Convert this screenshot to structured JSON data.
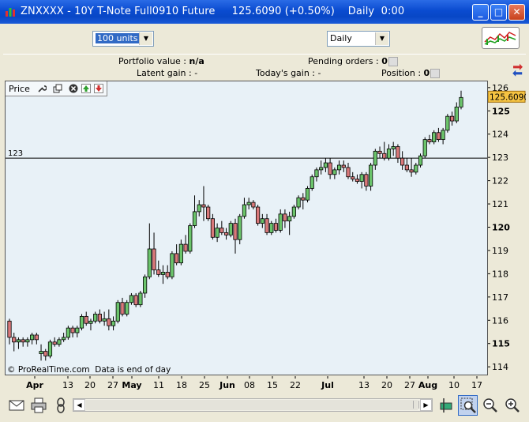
{
  "window": {
    "title": "ZNXXXX - 10Y T-Note Full0910 Future     125.6090 (+0.50%)    Daily  0:00",
    "minimize_label": "_",
    "maximize_label": "□",
    "close_label": "✕"
  },
  "toolbar": {
    "units_value": "100 units",
    "timeframe_value": "Daily"
  },
  "info": {
    "portfolio_label": "Portfolio value : ",
    "portfolio_value": "n/a",
    "pending_label": "Pending orders : ",
    "pending_value": "0",
    "latent_label": "Latent gain : ",
    "latent_value": "-",
    "todays_label": "Today's gain : ",
    "todays_value": "-",
    "position_label": "Position : ",
    "position_value": "0"
  },
  "chart_panel": {
    "name": "Price",
    "copyright": "© ProRealTime.com  Data is end of day",
    "hline_label": "123",
    "current_price_label": "125.6090"
  },
  "colors": {
    "up": "#6bc46b",
    "down": "#d9787a",
    "current_price_bg": "#f5c342"
  },
  "chart_data": {
    "type": "candlestick",
    "ylim": [
      113.7,
      126.3
    ],
    "yticks": [
      "126",
      "125",
      "124",
      "123",
      "122",
      "121",
      "120",
      "119",
      "118",
      "117",
      "116",
      "115",
      "114"
    ],
    "bold_yticks": [
      "125",
      "120",
      "115"
    ],
    "xticks": [
      "Apr",
      "13",
      "20",
      "27",
      "May",
      "11",
      "18",
      "25",
      "Jun",
      "08",
      "15",
      "22",
      "Jul",
      "13",
      "20",
      "27",
      "Aug",
      "10",
      "17"
    ],
    "bold_xticks": [
      "Apr",
      "May",
      "Jun",
      "Jul",
      "Aug"
    ],
    "horizontal_line": 123,
    "last_price": 125.609,
    "ohlc": [
      [
        116.0,
        116.1,
        115.0,
        115.3
      ],
      [
        115.3,
        115.5,
        114.7,
        115.1
      ],
      [
        115.1,
        115.3,
        114.8,
        115.2
      ],
      [
        115.2,
        115.3,
        114.9,
        115.1
      ],
      [
        115.1,
        115.3,
        114.9,
        115.2
      ],
      [
        115.2,
        115.5,
        115.0,
        115.4
      ],
      [
        115.4,
        115.5,
        115.0,
        115.2
      ],
      [
        114.6,
        115.0,
        114.3,
        114.7
      ],
      [
        114.7,
        114.8,
        114.3,
        114.5
      ],
      [
        114.5,
        115.2,
        114.4,
        115.1
      ],
      [
        115.1,
        115.3,
        114.9,
        115.0
      ],
      [
        115.0,
        115.3,
        114.9,
        115.2
      ],
      [
        115.2,
        115.5,
        115.1,
        115.3
      ],
      [
        115.3,
        115.8,
        115.2,
        115.7
      ],
      [
        115.7,
        115.8,
        115.3,
        115.5
      ],
      [
        115.5,
        115.8,
        115.3,
        115.7
      ],
      [
        115.7,
        116.3,
        115.6,
        116.2
      ],
      [
        116.2,
        116.4,
        115.8,
        115.9
      ],
      [
        115.9,
        116.1,
        115.6,
        116.0
      ],
      [
        116.0,
        116.4,
        115.9,
        116.3
      ],
      [
        116.3,
        116.5,
        115.9,
        116.0
      ],
      [
        116.0,
        116.4,
        115.8,
        116.1
      ],
      [
        116.1,
        116.5,
        115.6,
        115.8
      ],
      [
        115.8,
        116.2,
        115.6,
        116.0
      ],
      [
        116.0,
        116.9,
        115.9,
        116.8
      ],
      [
        116.8,
        117.0,
        116.2,
        116.3
      ],
      [
        116.3,
        116.9,
        116.2,
        116.8
      ],
      [
        116.8,
        117.2,
        116.7,
        117.1
      ],
      [
        117.1,
        117.2,
        116.6,
        116.7
      ],
      [
        116.7,
        117.3,
        116.6,
        117.2
      ],
      [
        117.2,
        118.0,
        117.0,
        117.9
      ],
      [
        117.9,
        120.2,
        117.8,
        119.1
      ],
      [
        119.1,
        119.8,
        118.0,
        118.2
      ],
      [
        118.2,
        118.6,
        117.9,
        118.0
      ],
      [
        118.0,
        118.4,
        117.6,
        118.1
      ],
      [
        118.1,
        118.4,
        117.8,
        117.9
      ],
      [
        117.9,
        119.0,
        117.8,
        118.9
      ],
      [
        118.9,
        119.3,
        118.4,
        118.5
      ],
      [
        118.5,
        119.5,
        118.4,
        119.3
      ],
      [
        119.3,
        119.7,
        118.9,
        119.0
      ],
      [
        119.0,
        120.2,
        118.9,
        120.1
      ],
      [
        120.1,
        121.4,
        120.0,
        120.7
      ],
      [
        120.7,
        121.2,
        120.5,
        121.0
      ],
      [
        121.0,
        121.8,
        120.3,
        120.9
      ],
      [
        120.9,
        121.0,
        120.3,
        120.4
      ],
      [
        120.4,
        120.6,
        119.5,
        119.6
      ],
      [
        119.6,
        120.2,
        119.4,
        120.0
      ],
      [
        120.0,
        120.3,
        119.7,
        119.8
      ],
      [
        119.8,
        120.0,
        119.5,
        119.7
      ],
      [
        119.7,
        120.3,
        119.6,
        120.2
      ],
      [
        120.2,
        120.4,
        118.9,
        119.5
      ],
      [
        119.5,
        120.6,
        119.3,
        120.5
      ],
      [
        120.5,
        121.3,
        120.4,
        121.0
      ],
      [
        121.0,
        121.3,
        120.8,
        121.1
      ],
      [
        121.1,
        121.2,
        120.8,
        120.9
      ],
      [
        120.9,
        121.0,
        120.1,
        120.2
      ],
      [
        120.2,
        120.6,
        120.0,
        120.4
      ],
      [
        120.4,
        120.6,
        119.7,
        119.8
      ],
      [
        119.8,
        120.3,
        119.7,
        120.2
      ],
      [
        120.2,
        120.4,
        119.8,
        119.9
      ],
      [
        119.9,
        120.8,
        119.8,
        120.6
      ],
      [
        120.6,
        120.8,
        120.0,
        120.3
      ],
      [
        120.3,
        120.7,
        119.7,
        120.5
      ],
      [
        120.5,
        121.0,
        120.4,
        120.9
      ],
      [
        120.9,
        121.4,
        120.8,
        121.3
      ],
      [
        121.3,
        121.5,
        120.8,
        121.2
      ],
      [
        121.2,
        121.8,
        121.1,
        121.7
      ],
      [
        121.7,
        122.3,
        121.6,
        122.2
      ],
      [
        122.2,
        122.6,
        122.0,
        122.5
      ],
      [
        122.5,
        122.9,
        122.3,
        122.6
      ],
      [
        122.6,
        123.0,
        122.4,
        122.8
      ],
      [
        122.8,
        123.0,
        122.1,
        122.3
      ],
      [
        122.3,
        122.6,
        122.1,
        122.5
      ],
      [
        122.5,
        122.9,
        122.3,
        122.7
      ],
      [
        122.7,
        122.9,
        122.4,
        122.6
      ],
      [
        122.6,
        122.8,
        122.1,
        122.2
      ],
      [
        122.2,
        122.4,
        122.0,
        122.1
      ],
      [
        122.1,
        122.3,
        121.9,
        122.0
      ],
      [
        122.0,
        122.4,
        121.7,
        122.3
      ],
      [
        122.3,
        122.4,
        121.6,
        121.8
      ],
      [
        121.8,
        122.8,
        121.6,
        122.7
      ],
      [
        122.7,
        123.4,
        122.5,
        123.3
      ],
      [
        123.3,
        123.5,
        123.0,
        123.2
      ],
      [
        123.2,
        123.7,
        122.9,
        123.0
      ],
      [
        123.0,
        123.6,
        122.9,
        123.4
      ],
      [
        123.4,
        123.7,
        123.1,
        123.5
      ],
      [
        123.5,
        123.6,
        122.8,
        123.0
      ],
      [
        123.0,
        123.3,
        122.5,
        122.7
      ],
      [
        122.7,
        123.0,
        122.4,
        122.5
      ],
      [
        122.5,
        123.0,
        122.2,
        122.4
      ],
      [
        122.4,
        122.8,
        122.3,
        122.7
      ],
      [
        122.7,
        123.2,
        122.6,
        123.1
      ],
      [
        123.1,
        123.9,
        123.0,
        123.8
      ],
      [
        123.8,
        124.0,
        123.6,
        123.7
      ],
      [
        123.7,
        124.2,
        123.6,
        124.1
      ],
      [
        124.1,
        124.3,
        123.7,
        123.8
      ],
      [
        123.8,
        124.3,
        123.6,
        124.2
      ],
      [
        124.2,
        124.9,
        124.1,
        124.8
      ],
      [
        124.8,
        125.0,
        124.4,
        124.6
      ],
      [
        124.6,
        125.4,
        124.5,
        125.2
      ],
      [
        125.2,
        125.9,
        125.1,
        125.61
      ]
    ]
  }
}
